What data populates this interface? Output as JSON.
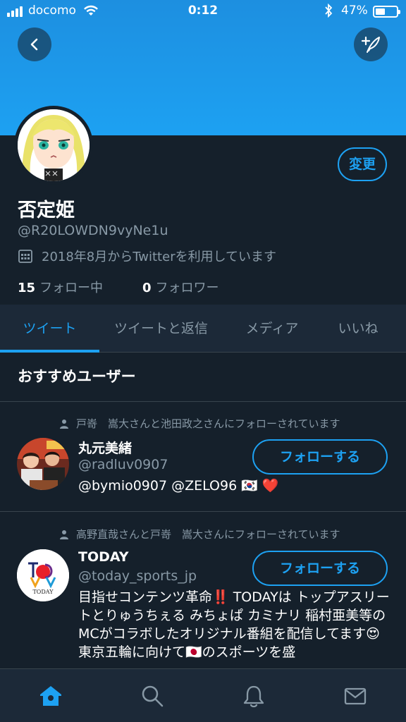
{
  "status_bar": {
    "carrier": "docomo",
    "time": "0:12",
    "battery_percent": "47%",
    "battery_level": 0.47,
    "icons": [
      "signal-icon",
      "wifi-icon",
      "bluetooth-icon",
      "battery-icon"
    ]
  },
  "header": {
    "back_icon": "chevron-left-icon",
    "compose_icon": "compose-tweet-icon",
    "banner_color": "#1da1f2"
  },
  "profile": {
    "display_name": "否定姫",
    "handle": "@R20LOWDN9vyNe1u",
    "joined": "2018年8月からTwitterを利用しています",
    "edit_label": "変更",
    "following_count": "15",
    "following_label": "フォロー中",
    "followers_count": "0",
    "followers_label": "フォロワー"
  },
  "tabs": [
    {
      "label": "ツイート",
      "active": true
    },
    {
      "label": "ツイートと返信",
      "active": false
    },
    {
      "label": "メディア",
      "active": false
    },
    {
      "label": "いいね",
      "active": false
    }
  ],
  "recommended": {
    "title": "おすすめユーザー",
    "users": [
      {
        "context": "戸嵜　嵩大さんと池田政之さんにフォローされています",
        "name": "丸元美緒",
        "handle": "@radluv0907",
        "bio": "@bymio0907 @ZELO96 🇰🇷 ❤️",
        "follow_label": "フォローする"
      },
      {
        "context": "高野直哉さんと戸嵜　嵩大さんにフォローされています",
        "name": "TODAY",
        "handle": "@today_sports_jp",
        "bio": "目指せコンテンツ革命‼️ TODAYは トップアスリートとりゅうちぇる みちょぱ カミナリ 稲村亜美等のMCがコラボしたオリジナル番組を配信してます😍 東京五輪に向けて🇯🇵のスポーツを盛",
        "follow_label": "フォローする",
        "logo_text": "TODAY"
      }
    ]
  },
  "bottom_nav": [
    {
      "name": "home-icon",
      "active": true
    },
    {
      "name": "search-icon",
      "active": false
    },
    {
      "name": "notifications-icon",
      "active": false
    },
    {
      "name": "messages-icon",
      "active": false
    }
  ],
  "colors": {
    "accent": "#1da1f2",
    "background": "#15202b",
    "surface": "#1c2938",
    "muted_text": "#8899a6"
  }
}
